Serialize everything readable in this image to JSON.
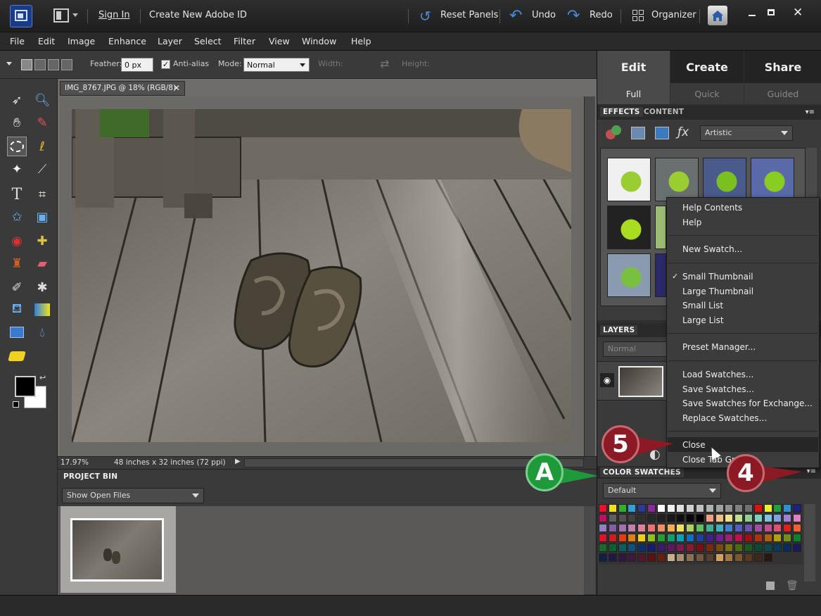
{
  "titlebar": {
    "sign_in": "Sign In",
    "create_id": "Create New Adobe ID",
    "reset_panels": "Reset Panels",
    "undo": "Undo",
    "redo": "Redo",
    "organizer": "Organizer"
  },
  "menubar": [
    "File",
    "Edit",
    "Image",
    "Enhance",
    "Layer",
    "Select",
    "Filter",
    "View",
    "Window",
    "Help"
  ],
  "options": {
    "feather_label": "Feather:",
    "feather_value": "0 px",
    "antialias_label": "Anti-alias",
    "antialias_checked": true,
    "mode_label": "Mode:",
    "mode_value": "Normal",
    "width_label": "Width:",
    "height_label": "Height:"
  },
  "document": {
    "tab_title": "IMG_8767.JPG @ 18% (RGB/8)",
    "zoom": "17.97%",
    "doc_size": "48 inches x 32 inches (72 ppi)"
  },
  "project_bin": {
    "title": "PROJECT BIN",
    "filter": "Show Open Files"
  },
  "right_panel": {
    "main_tabs": [
      "Edit",
      "Create",
      "Share"
    ],
    "sub_tabs": [
      "Full",
      "Quick",
      "Guided"
    ],
    "effects_tab": "EFFECTS",
    "content_tab": "CONTENT",
    "effects_category": "Artistic",
    "layers_title": "LAYERS",
    "blend_mode": "Normal",
    "swatches_title": "COLOR SWATCHES",
    "swatches_set": "Default"
  },
  "context_menu": {
    "items": [
      "Help Contents",
      "Help",
      "New Swatch...",
      "Small Thumbnail",
      "Large Thumbnail",
      "Small List",
      "Large List",
      "Preset Manager...",
      "Load Swatches...",
      "Save Swatches...",
      "Save Swatches for Exchange...",
      "Replace Swatches...",
      "Close",
      "Close Tab Group"
    ],
    "checked_item": "Small Thumbnail",
    "highlighted_item": "Close"
  },
  "callouts": {
    "step5": "5",
    "step4": "4",
    "labelA": "A"
  },
  "colors": {
    "callout_red": "#8b1a24",
    "callout_green": "#1f9a3a",
    "menu_bg": "#3c3c3c"
  },
  "swatch_colors": [
    [
      "#e8102a",
      "#f0e020",
      "#30b030",
      "#30a0d8",
      "#2a3a9a",
      "#8a2a9a",
      "#ffffff",
      "#f0f0f0",
      "#e0e0e0",
      "#d0d0d0",
      "#c0c0c0",
      "#b0b0b0",
      "#a0a0a0",
      "#909090",
      "#808080",
      "#707070",
      "#e01010",
      "#f0f020",
      "#20a040",
      "#3090d0",
      "#202080"
    ],
    [
      "#c01060",
      "#606060",
      "#505050",
      "#404040",
      "#303030",
      "#282828",
      "#202020",
      "#181818",
      "#101010",
      "#080808",
      "#000000",
      "#f0a080",
      "#f0c080",
      "#f0e090",
      "#c0e090",
      "#90d090",
      "#80d0c0",
      "#80c0e0",
      "#80a0e0",
      "#a080d0",
      "#e080c0"
    ],
    [
      "#9080c0",
      "#8060a0",
      "#a070b0",
      "#c080b0",
      "#e080a0",
      "#f07070",
      "#f09060",
      "#f0b050",
      "#f0e060",
      "#b0d060",
      "#60c060",
      "#40b090",
      "#40b0c0",
      "#4080d0",
      "#5060c0",
      "#7050b0",
      "#a050a0",
      "#c05090",
      "#e05070",
      "#e02020",
      "#f06030"
    ],
    [
      "#e01030",
      "#c82020",
      "#e04010",
      "#e08010",
      "#f0d010",
      "#90c020",
      "#20a030",
      "#10a070",
      "#10a0b0",
      "#1070c0",
      "#2040a0",
      "#402090",
      "#702090",
      "#a02070",
      "#c01050",
      "#a01010",
      "#b03010",
      "#b06010",
      "#b0a010",
      "#70901a",
      "#10802a"
    ],
    [
      "#1a6a2a",
      "#0a6030",
      "#0a6060",
      "#0a5080",
      "#0a3070",
      "#1a1a70",
      "#3a1a70",
      "#5a1a60",
      "#7a1a50",
      "#8a1a30",
      "#7a1010",
      "#7a2a10",
      "#7a4a10",
      "#7a7010",
      "#4a6a10",
      "#1a5a20",
      "#0a4a30",
      "#0a4a4a",
      "#0a3a5a",
      "#0a2a5a",
      "#1a1a5a"
    ],
    [
      "#102040",
      "#201840",
      "#301840",
      "#401840",
      "#501828",
      "#601010",
      "#6a2010",
      "#c8b090",
      "#a89070",
      "#887050",
      "#705840",
      "#584030",
      "#d0a060",
      "#a07840",
      "#785830",
      "#583820",
      "#402818",
      "#281810"
    ]
  ]
}
